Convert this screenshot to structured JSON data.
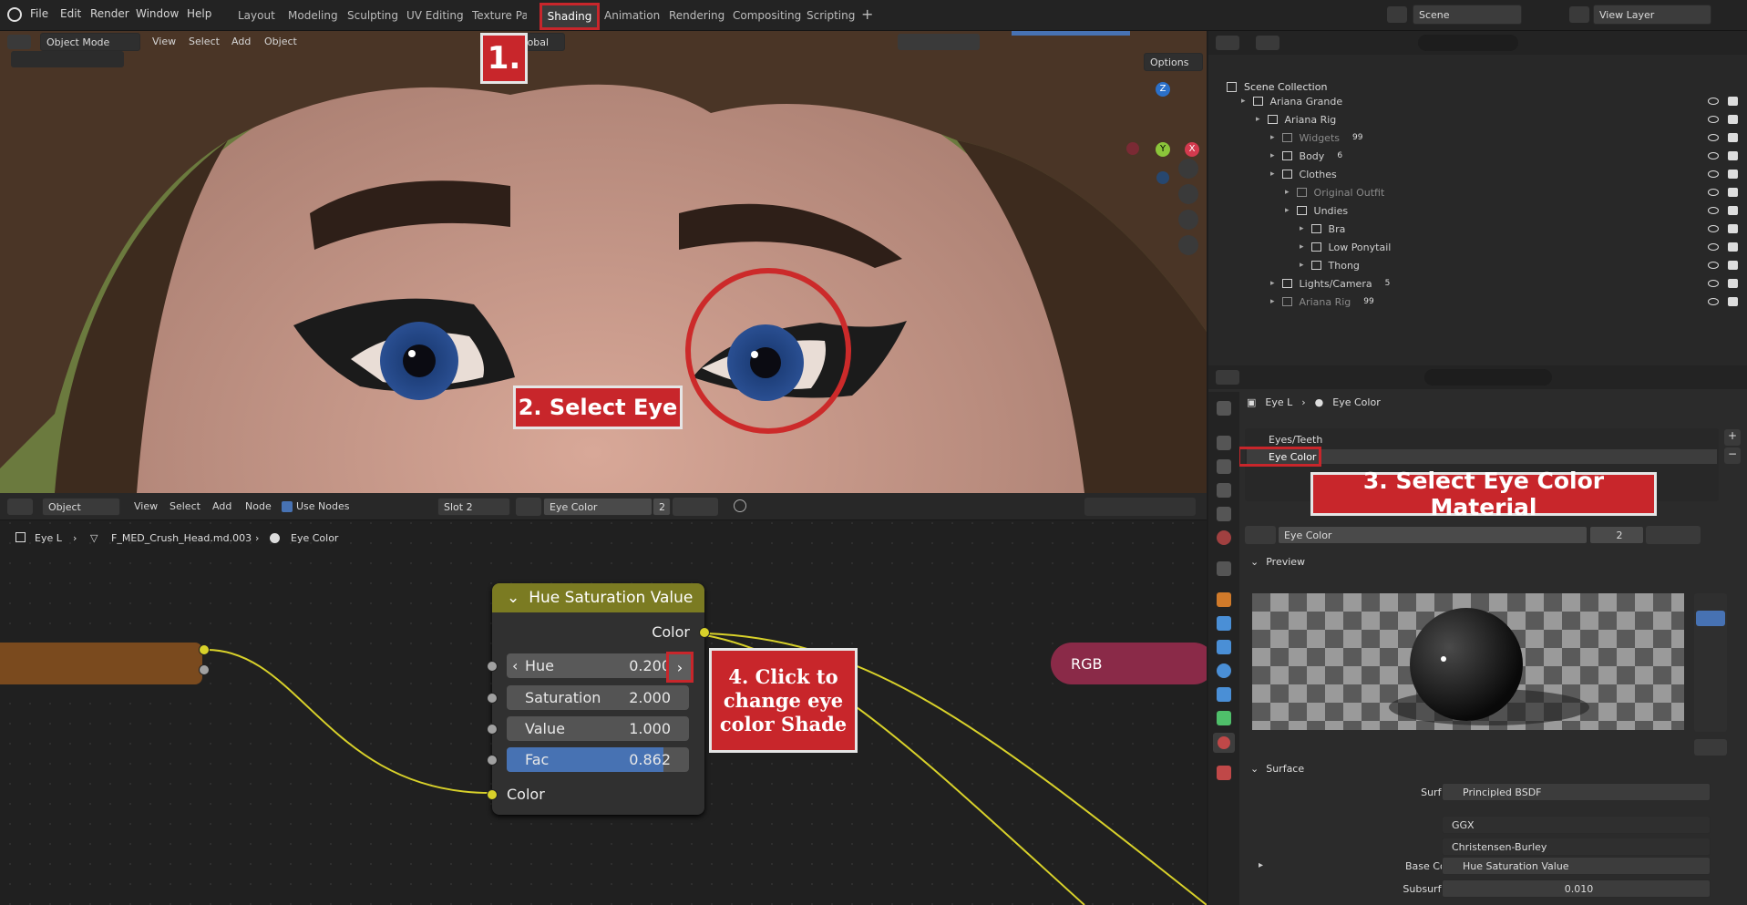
{
  "topbar": {
    "menus": [
      "File",
      "Edit",
      "Render",
      "Window",
      "Help"
    ],
    "workspaces": [
      "Layout",
      "Modeling",
      "Sculpting",
      "UV Editing",
      "Texture Paint",
      "Shading",
      "Animation",
      "Rendering",
      "Compositing",
      "Scripting"
    ],
    "active_workspace": "Shading",
    "add_tab": "+",
    "scene": "Scene",
    "view_layer": "View Layer"
  },
  "viewport": {
    "mode": "Object Mode",
    "menus": [
      "View",
      "Select",
      "Add",
      "Object"
    ],
    "orientation": "Global",
    "options": "Options",
    "gizmo": {
      "z": "Z",
      "y": "Y",
      "x": "X"
    }
  },
  "annotations": {
    "step1": "1.",
    "step2": "2. Select Eye",
    "step3": "3. Select Eye Color Material",
    "step4": "4. Click to change eye color Shade"
  },
  "node_editor": {
    "type": "Object",
    "menus": [
      "View",
      "Select",
      "Add",
      "Node"
    ],
    "use_nodes": "Use Nodes",
    "slot": "Slot 2",
    "material": "Eye Color",
    "users": "2",
    "breadcrumb": [
      "Eye L",
      "F_MED_Crush_Head.md.003",
      "Eye Color"
    ]
  },
  "hsv_node": {
    "title": "Hue Saturation Value",
    "out_color": "Color",
    "in_color": "Color",
    "fields": [
      {
        "label": "Hue",
        "value": "0.200"
      },
      {
        "label": "Saturation",
        "value": "2.000"
      },
      {
        "label": "Value",
        "value": "1.000"
      },
      {
        "label": "Fac",
        "value": "0.862"
      }
    ],
    "fac_fraction": 0.862
  },
  "rgb_node": {
    "title": "RGB"
  },
  "outliner": {
    "root": "Scene Collection",
    "items": [
      {
        "label": "Ariana Grande",
        "indent": 1,
        "color": "#cfcfcf",
        "badge": ""
      },
      {
        "label": "Ariana Rig",
        "indent": 2,
        "color": "#cfcfcf",
        "badge": ""
      },
      {
        "label": "Widgets",
        "indent": 3,
        "color": "#8a8a8a",
        "badge": "99"
      },
      {
        "label": "Body",
        "indent": 3,
        "color": "#cfcfcf",
        "badge": "6"
      },
      {
        "label": "Clothes",
        "indent": 3,
        "color": "#cfcfcf",
        "badge": ""
      },
      {
        "label": "Original Outfit",
        "indent": 4,
        "color": "#8a8a8a",
        "badge": ""
      },
      {
        "label": "Undies",
        "indent": 4,
        "color": "#cfcfcf",
        "badge": ""
      },
      {
        "label": "Bra",
        "indent": 5,
        "color": "#cfcfcf",
        "badge": ""
      },
      {
        "label": "Low Ponytail",
        "indent": 5,
        "color": "#cfcfcf",
        "badge": ""
      },
      {
        "label": "Thong",
        "indent": 5,
        "color": "#cfcfcf",
        "badge": ""
      },
      {
        "label": "Lights/Camera",
        "indent": 3,
        "color": "#cfcfcf",
        "badge": "5"
      },
      {
        "label": "Ariana Rig",
        "indent": 3,
        "color": "#8a8a8a",
        "badge": "99"
      }
    ]
  },
  "properties": {
    "breadcrumb": [
      "Eye L",
      "Eye Color"
    ],
    "slots": [
      "Eyes/Teeth",
      "Eye Color"
    ],
    "material": "Eye Color",
    "users": "2",
    "preview": "Preview",
    "surface_panel": "Surface",
    "surface_label": "Surface",
    "surface_value": "Principled BSDF",
    "distribution": "GGX",
    "subsurface_method": "Christensen-Burley",
    "base_color_label": "Base Color",
    "base_color_value": "Hue Saturation Value",
    "subsurface_label": "Subsurface",
    "subsurface_value": "0.010"
  }
}
